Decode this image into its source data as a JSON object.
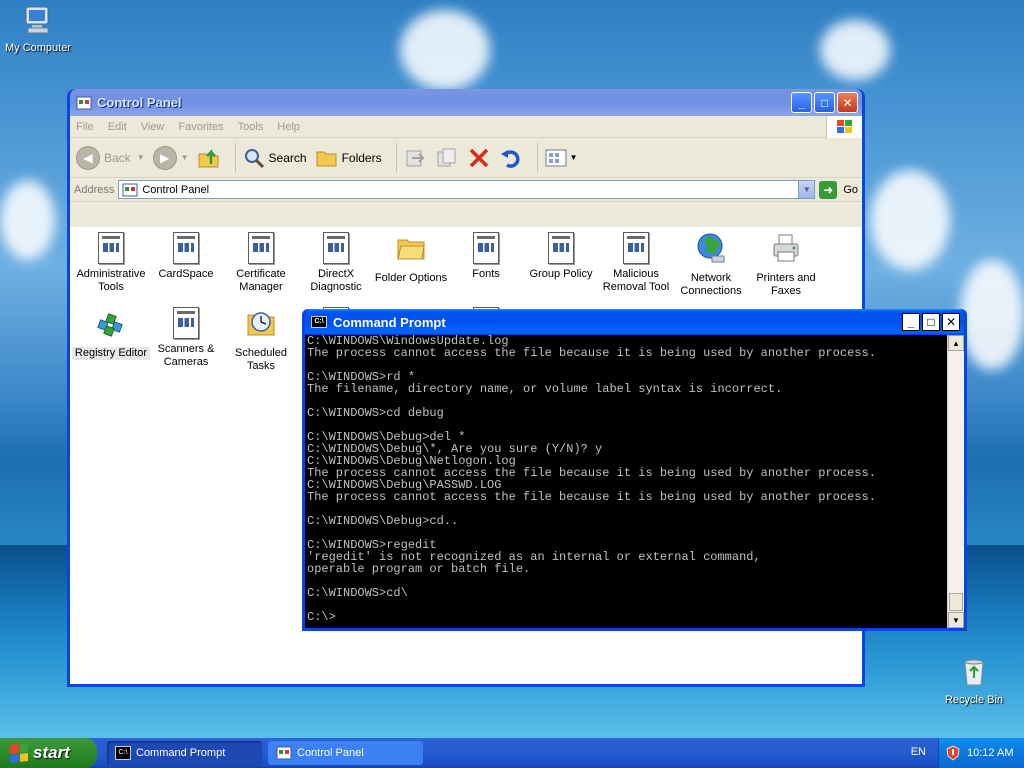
{
  "desktop": {
    "icons": [
      {
        "label": "My Computer"
      },
      {
        "label": "Recycle Bin"
      }
    ]
  },
  "control_panel": {
    "title": "Control Panel",
    "menu": [
      "File",
      "Edit",
      "View",
      "Favorites",
      "Tools",
      "Help"
    ],
    "toolbar": {
      "back_label": "Back",
      "search_label": "Search",
      "folders_label": "Folders"
    },
    "address": {
      "label": "Address",
      "value": "Control Panel",
      "go_label": "Go"
    },
    "items": [
      {
        "label": "Administrative Tools"
      },
      {
        "label": "CardSpace"
      },
      {
        "label": "Certificate Manager"
      },
      {
        "label": "DirectX Diagnostic"
      },
      {
        "label": "Folder Options"
      },
      {
        "label": "Fonts"
      },
      {
        "label": "Group Policy"
      },
      {
        "label": "Malicious Removal Tool"
      },
      {
        "label": "Network Connections"
      },
      {
        "label": "Printers and Faxes"
      },
      {
        "label": "Registry Editor"
      },
      {
        "label": "Scanners & Cameras"
      },
      {
        "label": "Scheduled Tasks"
      }
    ]
  },
  "command_prompt": {
    "title": "Command Prompt",
    "lines": [
      "C:\\WINDOWS\\WindowsUpdate.log",
      "The process cannot access the file because it is being used by another process.",
      "",
      "C:\\WINDOWS>rd *",
      "The filename, directory name, or volume label syntax is incorrect.",
      "",
      "C:\\WINDOWS>cd debug",
      "",
      "C:\\WINDOWS\\Debug>del *",
      "C:\\WINDOWS\\Debug\\*, Are you sure (Y/N)? y",
      "C:\\WINDOWS\\Debug\\Netlogon.log",
      "The process cannot access the file because it is being used by another process.",
      "C:\\WINDOWS\\Debug\\PASSWD.LOG",
      "The process cannot access the file because it is being used by another process.",
      "",
      "C:\\WINDOWS\\Debug>cd..",
      "",
      "C:\\WINDOWS>regedit",
      "'regedit' is not recognized as an internal or external command,",
      "operable program or batch file.",
      "",
      "C:\\WINDOWS>cd\\",
      "",
      "C:\\>"
    ]
  },
  "taskbar": {
    "start_label": "start",
    "tasks": [
      {
        "label": "Command Prompt"
      },
      {
        "label": "Control Panel"
      }
    ],
    "language": "EN",
    "clock": "10:12 AM"
  }
}
